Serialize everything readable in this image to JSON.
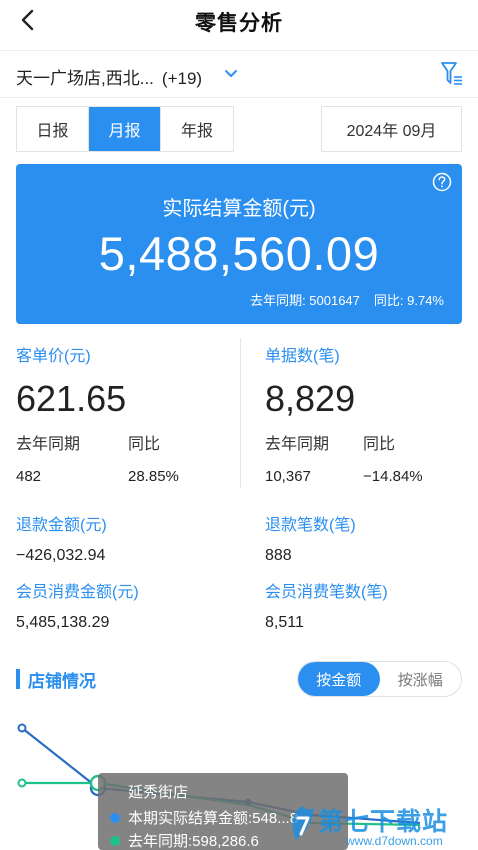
{
  "header": {
    "title": "零售分析",
    "back_icon": "chevron-left-icon"
  },
  "store_filter": {
    "stores_text": "天一广场店,西北...",
    "extra_count": "(+19)",
    "dropdown_icon": "chevron-down-icon",
    "filter_icon": "filter-icon"
  },
  "period": {
    "tabs": [
      {
        "label": "日报",
        "active": false
      },
      {
        "label": "月报",
        "active": true
      },
      {
        "label": "年报",
        "active": false
      }
    ],
    "date": "2024年 09月"
  },
  "hero": {
    "label": "实际结算金额(元)",
    "value": "5,488,560.09",
    "last_year_text": "去年同期: 5001647",
    "yoy_text": "同比: 9.74%",
    "help_icon": "help-icon"
  },
  "avg_price": {
    "label": "客单价(元)",
    "value": "621.65",
    "last_year_label": "去年同期",
    "yoy_label": "同比",
    "last_year_value": "482",
    "yoy_value": "28.85%"
  },
  "orders": {
    "label": "单据数(笔)",
    "value": "8,829",
    "last_year_label": "去年同期",
    "yoy_label": "同比",
    "last_year_value": "10,367",
    "yoy_value": "−14.84%"
  },
  "refund_amount": {
    "label": "退款金额(元)",
    "value": "−426,032.94"
  },
  "refund_count": {
    "label": "退款笔数(笔)",
    "value": "888"
  },
  "member_amount": {
    "label": "会员消费金额(元)",
    "value": "5,485,138.29"
  },
  "member_count": {
    "label": "会员消费笔数(笔)",
    "value": "8,511"
  },
  "store_section": {
    "title": "店铺情况",
    "toggle": [
      {
        "label": "按金额",
        "active": true
      },
      {
        "label": "按涨幅",
        "active": false
      }
    ]
  },
  "colors": {
    "primary": "#2b8ff0",
    "series_current": "#2b6cc4",
    "series_last_year": "#1fc18a"
  },
  "tooltip": {
    "title": "延秀街店",
    "current_text": "本期实际结算金额:548...8",
    "last_year_text": "去年同期:598,286.6"
  },
  "chart_data": {
    "type": "line",
    "series": [
      {
        "name": "本期实际结算金额",
        "values": [
          null,
          null,
          null,
          null,
          null
        ]
      },
      {
        "name": "去年同期",
        "values": [
          null,
          598286.6,
          null,
          null,
          null
        ]
      }
    ]
  },
  "watermark": {
    "text": "第七下载站",
    "url": "www.d7down.com"
  }
}
